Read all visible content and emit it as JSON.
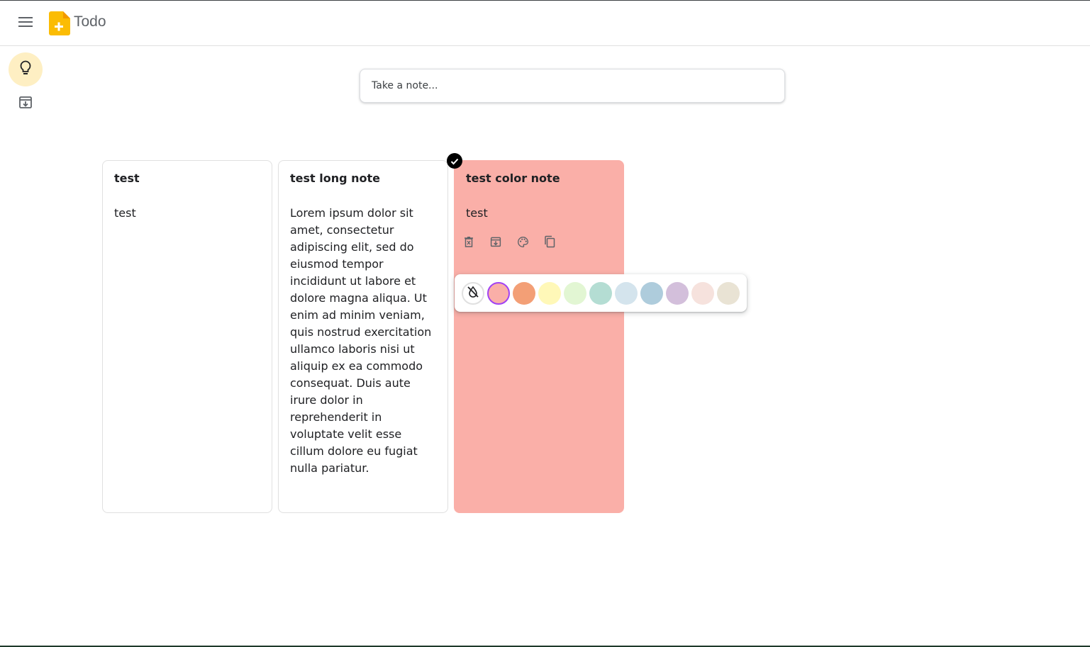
{
  "header": {
    "title": "Todo",
    "menu_icon": "hamburger-menu-icon",
    "logo_icon": "keep-logo-icon"
  },
  "sidebar": {
    "items": [
      {
        "name": "notes",
        "icon": "lightbulb-icon",
        "active": true
      },
      {
        "name": "archive",
        "icon": "archive-icon",
        "active": false
      }
    ]
  },
  "take_note": {
    "placeholder": "Take a note..."
  },
  "notes": [
    {
      "title": "test",
      "body": "test",
      "color": "#ffffff"
    },
    {
      "title": "test long note",
      "body": "Lorem ipsum dolor sit amet, consectetur adipiscing elit, sed do eiusmod tempor incididunt ut labore et dolore magna aliqua. Ut enim ad minim veniam, quis nostrud exercitation ullamco laboris nisi ut aliquip ex ea commodo consequat. Duis aute irure dolor in reprehenderit in voluptate velit esse cillum dolore eu fugiat nulla pariatur.",
      "color": "#ffffff"
    },
    {
      "title": "test color note",
      "body": "test",
      "color": "#faafa8",
      "selected": true
    }
  ],
  "note_actions": [
    "delete-icon",
    "archive-icon",
    "palette-icon",
    "copy-icon"
  ],
  "palette": {
    "no_color_icon": "no-color-icon",
    "colors": [
      "#faafa8",
      "#f39f76",
      "#fff8b8",
      "#e2f6d3",
      "#b4ddd3",
      "#d4e4ed",
      "#aeccdc",
      "#d3bfdb",
      "#f6e2dd",
      "#e9e3d4"
    ],
    "selected": "#faafa8"
  }
}
